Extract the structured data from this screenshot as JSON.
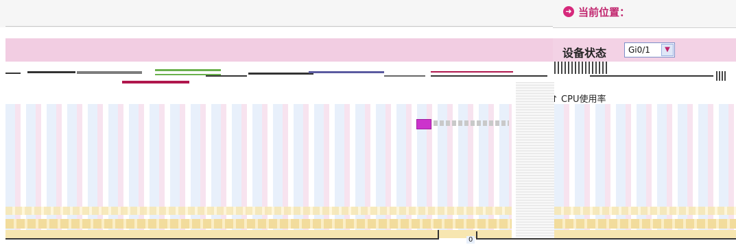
{
  "breadcrumb": {
    "icon": "arrow-circle-icon",
    "label": "当前位置："
  },
  "device_status": {
    "label": "设备状态",
    "port_select": {
      "value": "Gi0/1"
    }
  },
  "chart": {
    "series_label": "CPU使用率",
    "axis_zero": "0",
    "legend_color": "#cc33cc"
  },
  "colors": {
    "accent": "#c0246d",
    "pink_bar": "#f2cde2",
    "stripe_blue": "#e8f0fb"
  }
}
